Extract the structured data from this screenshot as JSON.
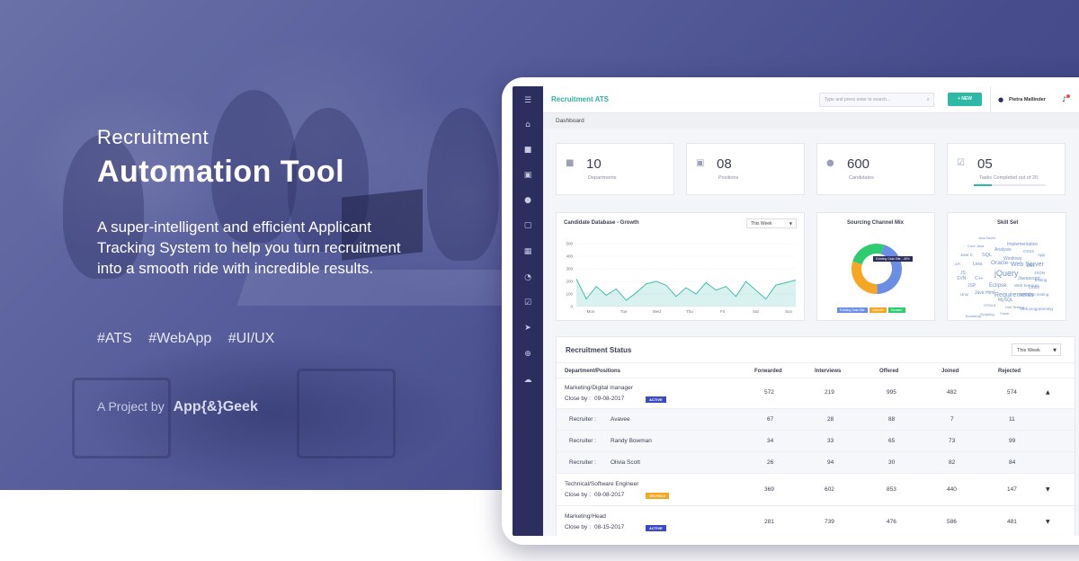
{
  "hero": {
    "kicker": "Recruitment",
    "title": "Automation Tool",
    "description": "A super-intelligent and efficient Applicant Tracking System to help you turn recruitment into a smooth ride with incredible results.",
    "tags": [
      "#ATS",
      "#WebApp",
      "#UI/UX"
    ],
    "byline": "A Project by",
    "company": "App{&}Geek"
  },
  "app": {
    "brand": "Recruitment ATS",
    "search_placeholder": "Type and press enter to search...",
    "new_button": "+ NEW",
    "user_name": "Pietra Mallinder",
    "breadcrumb": "Dashboard",
    "accent": "#2cb9a5",
    "sidebar_color": "#2c2f5e"
  },
  "stats": [
    {
      "value": "10",
      "label": "Departments",
      "icon": "briefcase-icon"
    },
    {
      "value": "08",
      "label": "Positions",
      "icon": "id-card-icon"
    },
    {
      "value": "600",
      "label": "Candidates",
      "icon": "users-icon"
    },
    {
      "value": "05",
      "label": "Tasks Completed out of 20",
      "icon": "checkbox-icon",
      "progress": 0.25
    }
  ],
  "growth": {
    "title": "Candidate Database - Growth",
    "filter": "This Week"
  },
  "sourcing": {
    "title": "Sourcing Channel Mix",
    "tooltip": "Existing Data Site - 45%",
    "legend": [
      "Existing Data Site",
      "LinkedIn",
      "Monster"
    ]
  },
  "skills": {
    "title": "Skill Set",
    "words": [
      "Java Servlet",
      "Implementation",
      "Core Java",
      "Analysis",
      "CSS3",
      "Jave C",
      "SQL",
      "Windows",
      "App",
      "API",
      "Less",
      "Oracle",
      "Web Server",
      "Dev",
      "JS",
      "jQuery",
      "JSON",
      "SVN",
      "C++",
      "Javascript",
      "Testing",
      "JSP",
      "Eclipse",
      "Web Services",
      "Linux",
      "Unix",
      "Java Html",
      "Requirements",
      "Software testing",
      "MySQL",
      "HTML5",
      "Unit Testing",
      "Scripting",
      "Bootstrap",
      "Oracle",
      "Web programming"
    ]
  },
  "status": {
    "title": "Recruitment Status",
    "filter": "This Week",
    "headers": [
      "Department/Positions",
      "Forwarded",
      "Interviews",
      "Offered",
      "Joined",
      "Rejected"
    ],
    "close_label": "Close by :",
    "recruiter_label": "Recruiter :",
    "rows": [
      {
        "dept": "Marketing/Digital manager",
        "close": "09-08-2017",
        "badge": "ACTIVE",
        "badge_color": "#3b4bbf",
        "vals": [
          "572",
          "219",
          "995",
          "482",
          "574"
        ],
        "chev": "▲",
        "recruiters": [
          {
            "name": "Avavee",
            "vals": [
              "67",
              "28",
              "88",
              "7",
              "11"
            ]
          },
          {
            "name": "Randy Bowman",
            "vals": [
              "34",
              "33",
              "65",
              "73",
              "99"
            ]
          },
          {
            "name": "Olivia Scott",
            "vals": [
              "26",
              "94",
              "30",
              "82",
              "84"
            ]
          }
        ]
      },
      {
        "dept": "Technical/Software Engineer",
        "close": "09-08-2017",
        "badge": "ON HOLD",
        "badge_color": "#f5a623",
        "vals": [
          "369",
          "602",
          "853",
          "440",
          "147"
        ],
        "chev": "▼"
      },
      {
        "dept": "Marketing/Head",
        "close": "08-15-2017",
        "badge": "ACTIVE",
        "badge_color": "#3b4bbf",
        "vals": [
          "281",
          "739",
          "476",
          "586",
          "481"
        ],
        "chev": "▼"
      }
    ]
  },
  "chart_data": {
    "type": "area",
    "title": "Candidate Database - Growth",
    "categories": [
      "Mon",
      "Tue",
      "Wed",
      "Thu",
      "Fri",
      "Sat",
      "Sun"
    ],
    "ylim": [
      0,
      500
    ],
    "yticks": [
      "0",
      "100",
      "200",
      "300",
      "400",
      "500"
    ],
    "values": [
      220,
      60,
      160,
      90,
      140,
      50,
      110,
      180,
      200,
      170,
      80,
      150,
      100,
      190,
      130,
      160,
      80,
      200,
      130,
      60,
      170,
      190,
      210
    ]
  },
  "donut_data": {
    "type": "pie",
    "title": "Sourcing Channel Mix",
    "categories": [
      "Existing Data Site",
      "LinkedIn",
      "Monster"
    ],
    "values": [
      45,
      30,
      25
    ],
    "colors": [
      "#6b8de3",
      "#f5a623",
      "#2ecc71"
    ]
  }
}
